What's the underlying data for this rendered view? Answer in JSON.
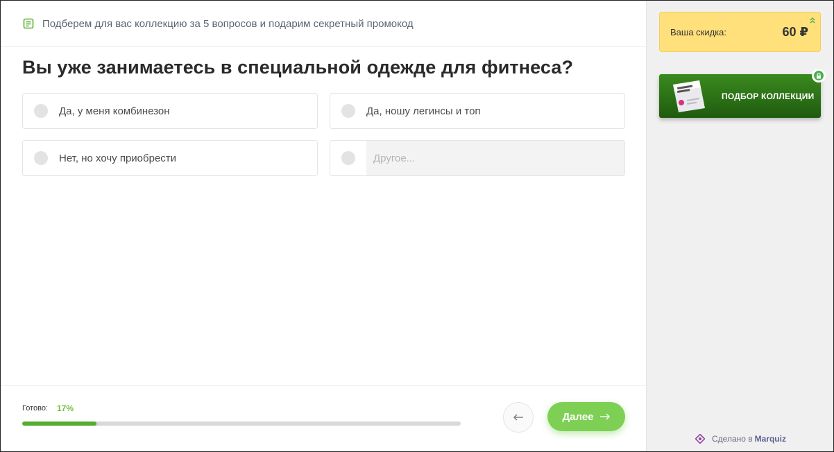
{
  "header": {
    "icon": "checklist-icon",
    "text": "Подберем для вас коллекцию за 5 вопросов и подарим секретный промокод"
  },
  "question": {
    "title": "Вы уже занимаетесь в специальной одежде для фитнеса?",
    "options": [
      {
        "label": "Да, у меня комбинезон"
      },
      {
        "label": "Да, ношу легинсы и топ"
      },
      {
        "label": "Нет, но хочу приобрести"
      }
    ],
    "other_placeholder": "Другое..."
  },
  "footer": {
    "progress_label": "Готово:",
    "progress_pct_text": "17%",
    "progress_value": 17,
    "back_icon": "arrow-left-icon",
    "next_label": "Далее",
    "next_icon": "arrow-right-icon"
  },
  "sidebar": {
    "discount_label": "Ваша скидка:",
    "discount_value": "60 ₽",
    "discount_icon": "double-chevron-up-icon",
    "collection_label": "ПОДБОР КОЛЛЕКЦИИ",
    "collection_lock_icon": "lock-icon",
    "made_by_prefix": "Сделано в",
    "made_by_brand": "Marquiz"
  },
  "colors": {
    "accent_green": "#7dd054",
    "progress_green": "#54ad2f",
    "discount_yellow": "#ffe07a",
    "collection_green": "#2e7a18"
  }
}
